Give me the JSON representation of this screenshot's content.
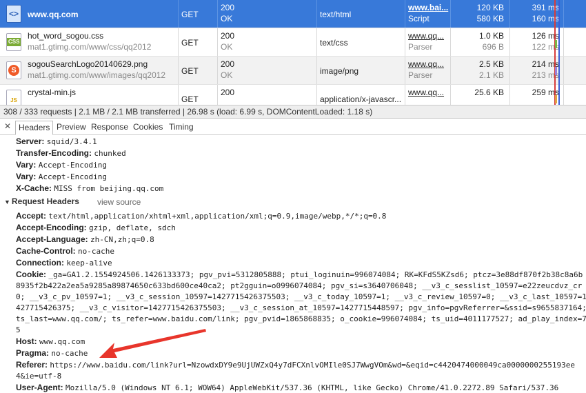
{
  "requests": [
    {
      "name": "www.qq.com",
      "path": "",
      "method": "GET",
      "status_code": "200",
      "status_text": "OK",
      "type": "text/html",
      "initiator": "www.bai...",
      "initiator_sub": "Script",
      "size": "120 KB",
      "content": "580 KB",
      "time": "391 ms",
      "latency": "160 ms",
      "icon": "html-file-icon",
      "icon_glyph": "<>"
    },
    {
      "name": "hot_word_sogou.css",
      "path": "mat1.gtimg.com/www/css/qq2012",
      "method": "GET",
      "status_code": "200",
      "status_text": "OK",
      "type": "text/css",
      "initiator": "www.qq...",
      "initiator_sub": "Parser",
      "size": "1.0 KB",
      "content": "696 B",
      "time": "126 ms",
      "latency": "122 ms",
      "icon": "css-file-icon",
      "icon_glyph": "CSS"
    },
    {
      "name": "sogouSearchLogo20140629.png",
      "path": "mat1.gtimg.com/www/images/qq2012",
      "method": "GET",
      "status_code": "200",
      "status_text": "OK",
      "type": "image/png",
      "initiator": "www.qq...",
      "initiator_sub": "Parser",
      "size": "2.5 KB",
      "content": "2.1 KB",
      "time": "214 ms",
      "latency": "213 ms",
      "icon": "sogou-logo-icon",
      "icon_glyph": "S"
    },
    {
      "name": "crystal-min.js",
      "path": "",
      "method": "GET",
      "status_code": "200",
      "status_text": "",
      "type": "application/x-javascr...",
      "initiator": "www.qq...",
      "initiator_sub": "",
      "size": "25.6 KB",
      "content": "",
      "time": "259 ms",
      "latency": "",
      "icon": "js-file-icon",
      "icon_glyph": "JS"
    }
  ],
  "summary": "308 / 333 requests | 2.1 MB / 2.1 MB transferred | 26.98 s (load: 6.99 s, DOMContentLoaded: 1.18 s)",
  "tabs": [
    "Headers",
    "Preview",
    "Response",
    "Cookies",
    "Timing"
  ],
  "response_headers": [
    {
      "key": "Server:",
      "value": "squid/3.4.1"
    },
    {
      "key": "Transfer-Encoding:",
      "value": "chunked"
    },
    {
      "key": "Vary:",
      "value": "Accept-Encoding"
    },
    {
      "key": "Vary:",
      "value": "Accept-Encoding"
    },
    {
      "key": "X-Cache:",
      "value": "MISS from beijing.qq.com"
    }
  ],
  "request_section": {
    "title": "Request Headers",
    "view_source": "view source"
  },
  "request_headers": {
    "accept": {
      "key": "Accept:",
      "value": "text/html,application/xhtml+xml,application/xml;q=0.9,image/webp,*/*;q=0.8"
    },
    "accept_encoding": {
      "key": "Accept-Encoding:",
      "value": "gzip, deflate, sdch"
    },
    "accept_language": {
      "key": "Accept-Language:",
      "value": "zh-CN,zh;q=0.8"
    },
    "cache_control": {
      "key": "Cache-Control:",
      "value": "no-cache"
    },
    "connection": {
      "key": "Connection:",
      "value": "keep-alive"
    },
    "cookie": {
      "key": "Cookie:",
      "value_lines": [
        "_ga=GA1.2.1554924506.1426133373; pgv_pvi=5312805888; ptui_loginuin=996074084; RK=KFdS5KZsd6; ptcz=3e88df870f2b38c8a6b",
        "8935f2b422a2ea5a9285a89874650c633bd600ce40ca2; pt2gguin=o0996074084; pgv_si=s3640706048; __v3_c_sesslist_10597=e22zeucdvz_cr",
        "0; __v3_c_pv_10597=1; __v3_c_session_10597=1427715426375503; __v3_c_today_10597=1; __v3_c_review_10597=0; __v3_c_last_10597=1",
        "427715426375; __v3_c_visitor=1427715426375503; __v3_c_session_at_10597=1427715448597; pgv_info=pgvReferrer=&ssid=s9655837164;",
        "ts_last=www.qq.com/; ts_refer=www.baidu.com/link; pgv_pvid=1865868835; o_cookie=996074084; ts_uid=4011177527; ad_play_index=7",
        "5"
      ]
    },
    "host": {
      "key": "Host:",
      "value": "www.qq.com"
    },
    "pragma": {
      "key": "Pragma:",
      "value": "no-cache"
    },
    "referer": {
      "key": "Referer:",
      "value_lines": [
        "https://www.baidu.com/link?url=NzowdxDY9e9UjUWZxQ4y7dFCXnlvOMIle0SJ7WwgVOm&wd=&eqid=c4420474000049ca0000000255193ee",
        "4&ie=utf-8"
      ]
    },
    "user_agent": {
      "key": "User-Agent:",
      "value": "Mozilla/5.0 (Windows NT 6.1; WOW64) AppleWebKit/537.36 (KHTML, like Gecko) Chrome/41.0.2272.89 Safari/537.36"
    }
  },
  "colors": {
    "selection": "#3879d9",
    "annotation_arrow": "#e8352b"
  }
}
